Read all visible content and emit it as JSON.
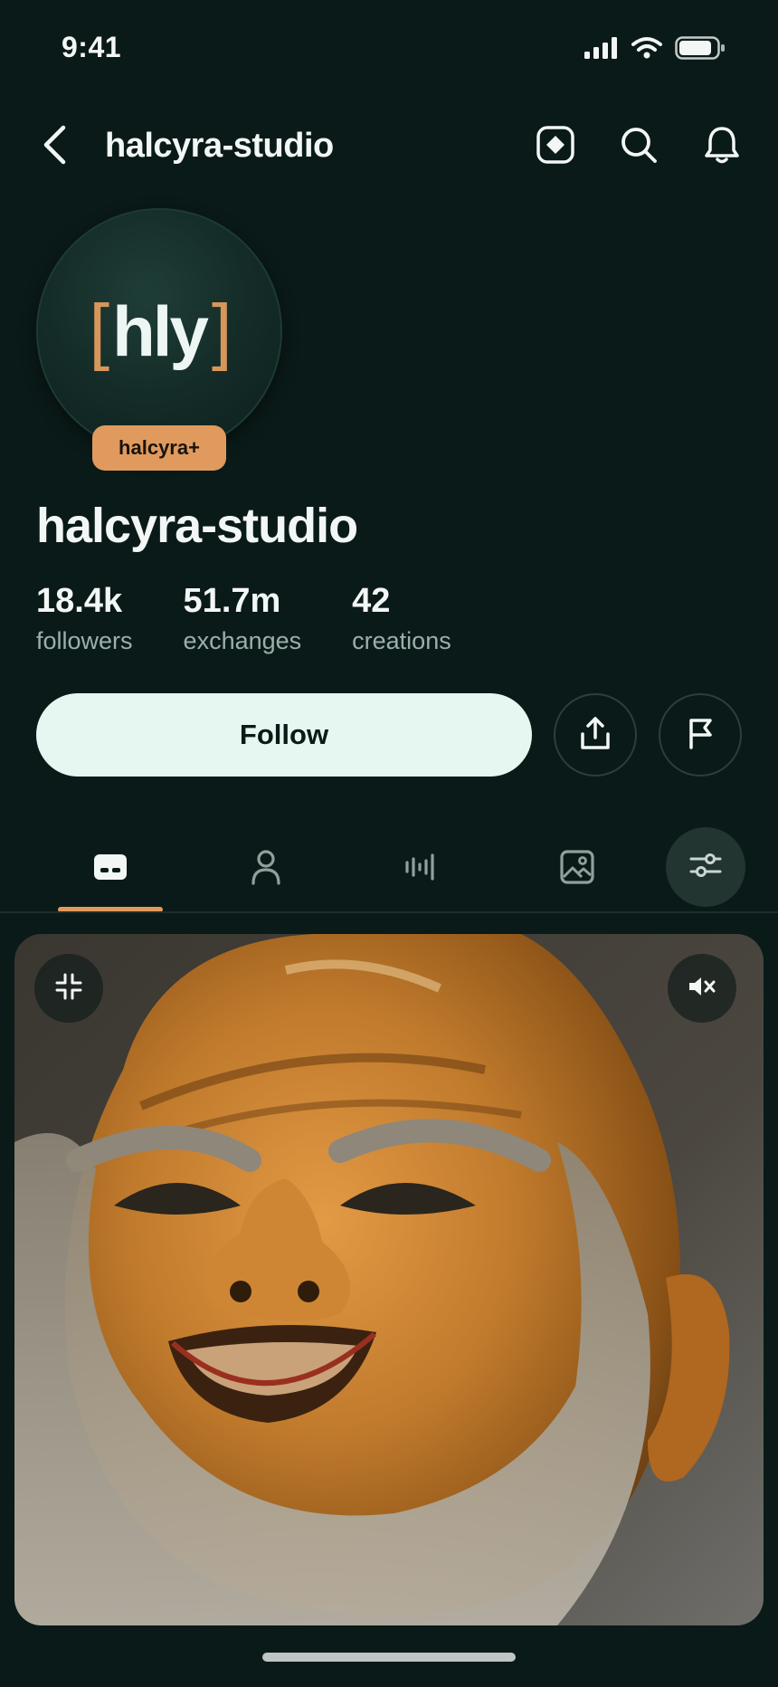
{
  "status_bar": {
    "time": "9:41"
  },
  "nav": {
    "title": "halcyra-studio"
  },
  "avatar": {
    "text": "hly",
    "bracket_left": "[",
    "bracket_right": "]"
  },
  "badge": {
    "label": "halcyra+"
  },
  "profile": {
    "name": "halcyra-studio",
    "stats": [
      {
        "value": "18.4k",
        "label": "followers"
      },
      {
        "value": "51.7m",
        "label": "exchanges"
      },
      {
        "value": "42",
        "label": "creations"
      }
    ]
  },
  "actions": {
    "follow_label": "Follow"
  },
  "tabs": [
    {
      "icon": "chat-card-icon",
      "selected": true
    },
    {
      "icon": "person-icon",
      "selected": false
    },
    {
      "icon": "audio-waveform-icon",
      "selected": false
    },
    {
      "icon": "image-icon",
      "selected": false
    }
  ],
  "colors": {
    "background": "#0a1a18",
    "accent": "#e09a5e",
    "follow_button": "#e6f7f1",
    "muted_text": "#9bb0ab"
  }
}
